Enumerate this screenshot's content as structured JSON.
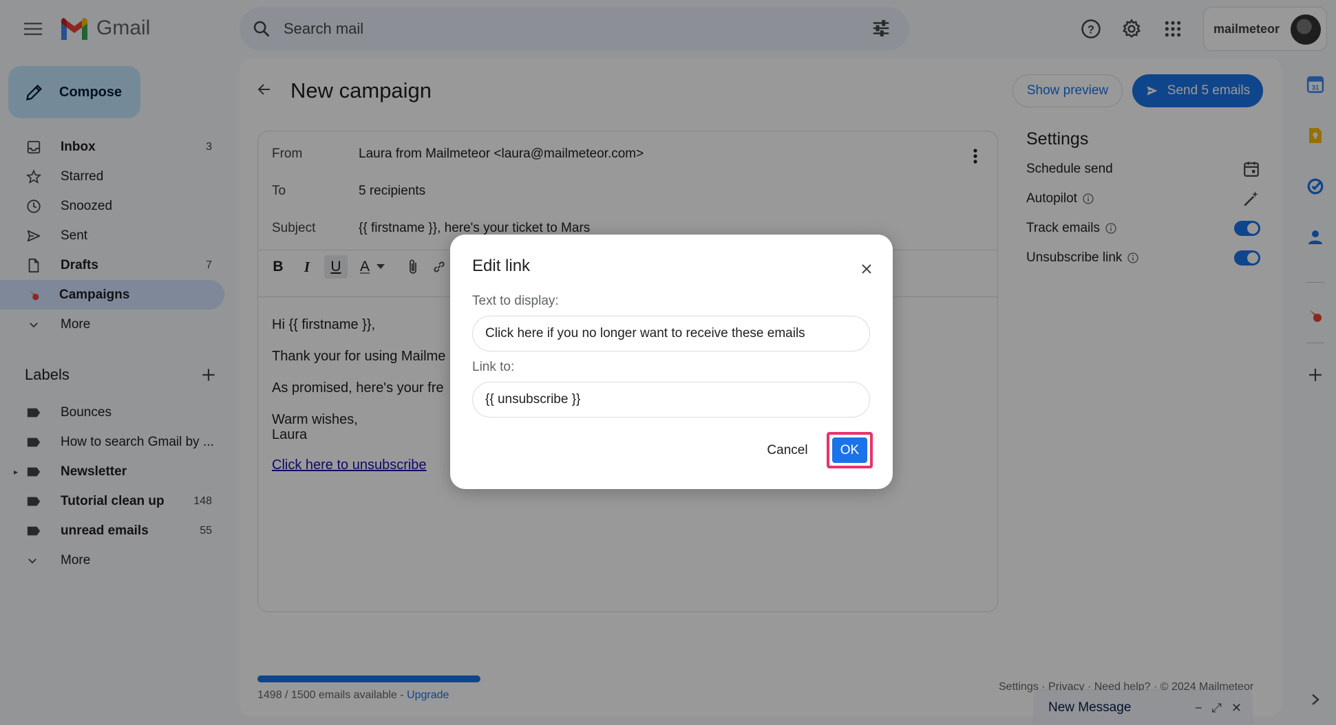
{
  "app": {
    "name": "Gmail"
  },
  "search": {
    "placeholder": "Search mail"
  },
  "account": {
    "name": "mailmeteor"
  },
  "compose": {
    "label": "Compose"
  },
  "nav": {
    "items": [
      {
        "label": "Inbox",
        "count": "3",
        "icon": "inbox-icon",
        "bold": true
      },
      {
        "label": "Starred",
        "count": "",
        "icon": "star-icon",
        "bold": false
      },
      {
        "label": "Snoozed",
        "count": "",
        "icon": "clock-icon",
        "bold": false
      },
      {
        "label": "Sent",
        "count": "",
        "icon": "send-icon",
        "bold": false
      },
      {
        "label": "Drafts",
        "count": "7",
        "icon": "draft-icon",
        "bold": true
      },
      {
        "label": "Campaigns",
        "count": "",
        "icon": "mailmeteor-icon",
        "bold": true,
        "active": true
      },
      {
        "label": "More",
        "count": "",
        "icon": "chevron-down-icon",
        "bold": false
      }
    ]
  },
  "labels": {
    "title": "Labels",
    "items": [
      {
        "label": "Bounces",
        "count": "",
        "bold": false
      },
      {
        "label": "How to search Gmail by ...",
        "count": "",
        "bold": false
      },
      {
        "label": "Newsletter",
        "count": "",
        "bold": true,
        "expandable": true
      },
      {
        "label": "Tutorial clean up",
        "count": "148",
        "bold": true
      },
      {
        "label": "unread emails",
        "count": "55",
        "bold": true
      }
    ],
    "more_label": "More"
  },
  "campaign": {
    "title": "New campaign",
    "show_preview": "Show preview",
    "send_button": "Send 5 emails",
    "from_label": "From",
    "from_value": "Laura from Mailmeteor <laura@mailmeteor.com>",
    "to_label": "To",
    "to_value": "5 recipients",
    "subject_label": "Subject",
    "subject_value": "{{ firstname }}, here's your ticket to Mars",
    "toolbar": {
      "bold": "B",
      "italic": "I",
      "underline": "U",
      "text_color": "A"
    },
    "body": {
      "greeting": "Hi {{ firstname }},",
      "line1": "Thank your for using Mailme",
      "line2": "As promised, here's your fre",
      "signoff1": "Warm wishes,",
      "signoff2": "Laura",
      "link": "Click here to unsubscribe"
    }
  },
  "settings": {
    "title": "Settings",
    "items": [
      {
        "label": "Schedule send",
        "control": "calendar-icon"
      },
      {
        "label": "Autopilot",
        "control": "magic-wand-icon",
        "info": true
      },
      {
        "label": "Track emails",
        "control": "toggle-on",
        "info": true
      },
      {
        "label": "Unsubscribe link",
        "control": "toggle-on",
        "info": true
      }
    ]
  },
  "quota": {
    "used_fraction": 0.9987,
    "text": "1498 / 1500 emails available - ",
    "upgrade": "Upgrade"
  },
  "footer": {
    "links": "Settings · Privacy · Need help? · © 2024 Mailmeteor"
  },
  "new_message": {
    "title": "New Message",
    "minimize": "−",
    "expand": "⤢",
    "close": "✕"
  },
  "dialog": {
    "title": "Edit link",
    "text_label": "Text to display:",
    "text_value": "Click here if you no longer want to receive these emails",
    "link_label": "Link to:",
    "link_value": "{{ unsubscribe }}",
    "cancel": "Cancel",
    "ok": "OK"
  },
  "colors": {
    "accent": "#1a73e8",
    "highlight": "#e8336a",
    "active_nav": "#d3e3fd",
    "compose_bg": "#c2e7ff"
  }
}
